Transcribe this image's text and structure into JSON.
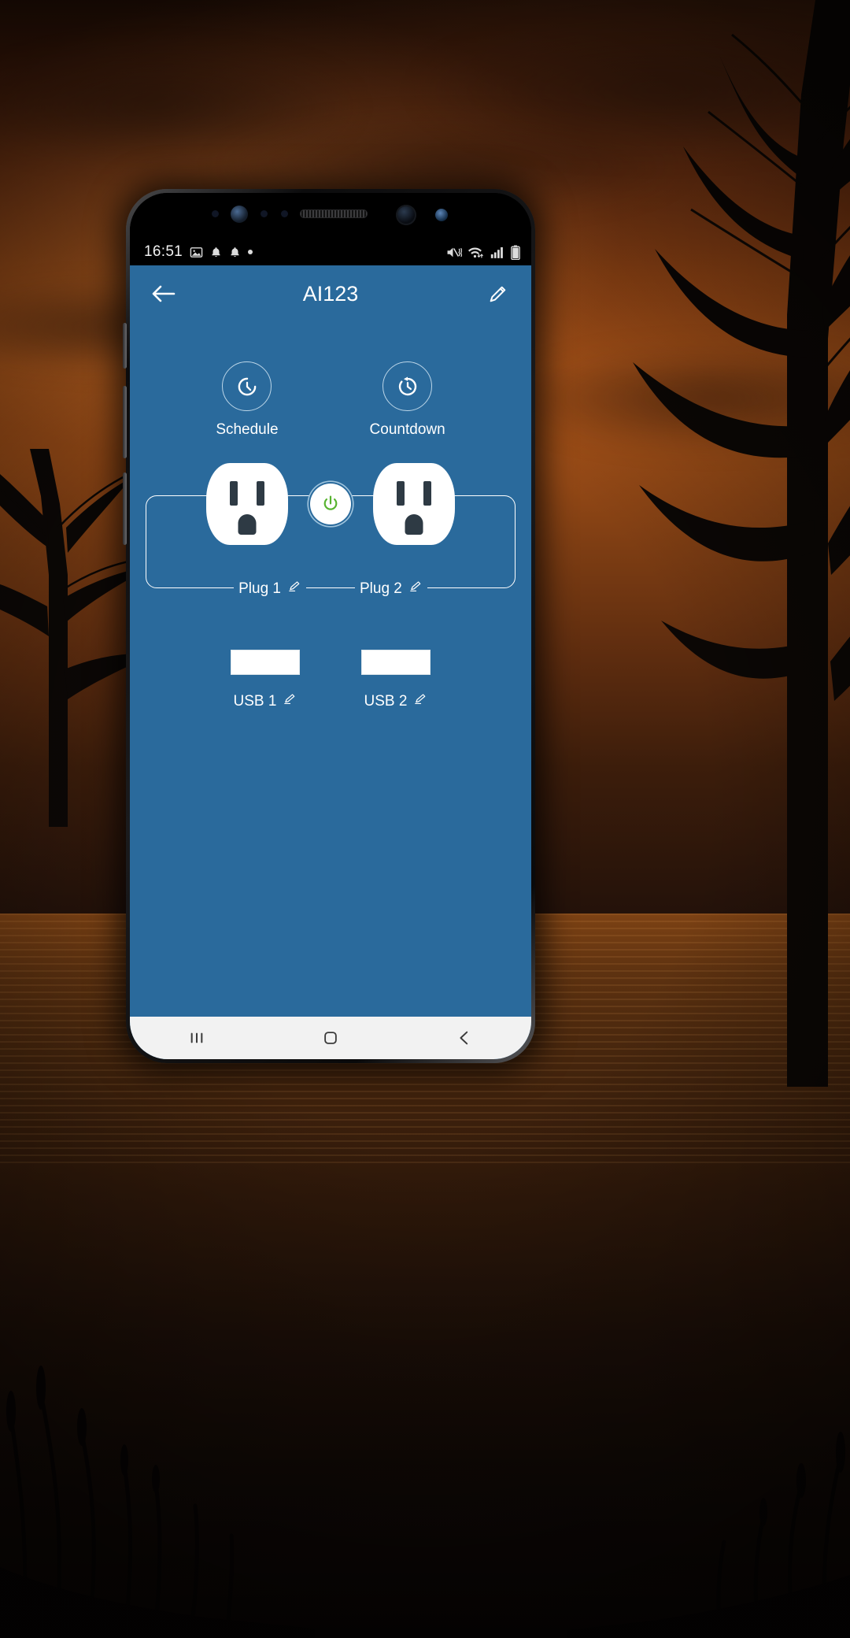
{
  "status_bar": {
    "time": "16:51",
    "left_icons": [
      "image-icon",
      "notification-bell-icon",
      "notification-bell-icon",
      "dot-icon"
    ],
    "right_icons": [
      "mute-vibrate-icon",
      "wifi-icon",
      "cellular-signal-icon",
      "battery-icon"
    ]
  },
  "app_bar": {
    "back_icon": "back-arrow-icon",
    "title": "AI123",
    "edit_icon": "pencil-edit-icon"
  },
  "quick_actions": [
    {
      "label": "Schedule",
      "icon": "timer-icon"
    },
    {
      "label": "Countdown",
      "icon": "countdown-timer-icon"
    }
  ],
  "plugs": [
    {
      "label": "Plug 1",
      "edit_icon": "pencil-edit-icon",
      "state": "on"
    },
    {
      "label": "Plug 2",
      "edit_icon": "pencil-edit-icon",
      "state": "on"
    }
  ],
  "power_button": {
    "icon": "power-icon",
    "color": "#57b330",
    "state": "on"
  },
  "usb_ports": [
    {
      "label": "USB 1",
      "edit_icon": "pencil-edit-icon"
    },
    {
      "label": "USB 2",
      "edit_icon": "pencil-edit-icon"
    }
  ],
  "nav_bar": {
    "recents_icon": "recents-icon",
    "home_icon": "home-icon",
    "back_icon": "back-chevron-icon"
  },
  "theme": {
    "app_background": "#2a6a9c",
    "accent_green": "#57b330",
    "text_on_blue": "#ffffff",
    "status_bar_background": "#000000",
    "nav_bar_background": "#f2f2f2"
  }
}
